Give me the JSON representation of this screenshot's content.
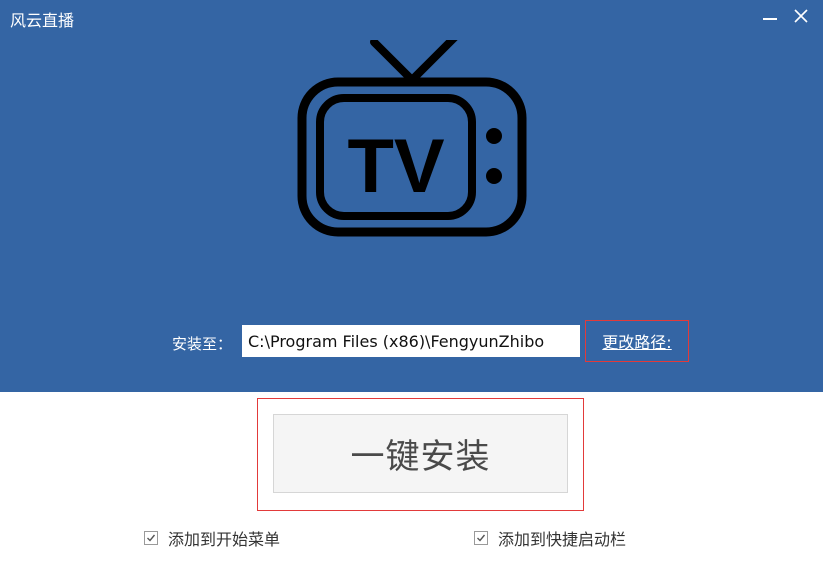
{
  "window": {
    "title": "风云直播"
  },
  "install": {
    "path_label": "安装至：",
    "path_value": "C:\\Program Files (x86)\\FengyunZhibo",
    "change_path_label": "更改路径:",
    "button_label": "一键安装"
  },
  "options": [
    {
      "label": "添加到开始菜单",
      "checked": true
    },
    {
      "label": "添加到快捷启动栏",
      "checked": true
    }
  ],
  "logo": {
    "text": "TV",
    "icon": "tv-icon"
  },
  "colors": {
    "header_bg": "#3465a4",
    "highlight_border": "#e23a3a"
  }
}
